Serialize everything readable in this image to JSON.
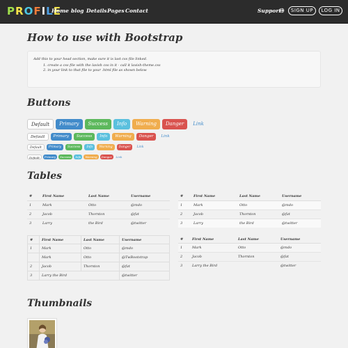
{
  "navbar": {
    "brand": [
      "P",
      "R",
      "O",
      "F",
      "I",
      "L",
      "E"
    ],
    "brand_colors": [
      "#a0e04c",
      "#f7e34a",
      "#4cc7e6",
      "#f57c3a",
      "#e6e6e6",
      "#4ca0e6",
      "#f7e34a"
    ],
    "links": [
      "Home",
      "blog",
      "Details",
      "Pages",
      "Contact"
    ],
    "support": "Support",
    "signup": "SIGN UP",
    "login": "LOG IN"
  },
  "main": {
    "title": "How to use with Bootstrap",
    "well": {
      "intro": "Add this to your head section, make sure it is last css file linked.",
      "step1": "1. create a css file with the lavish css in it - call it lavish-theme.css",
      "step2": "2. in your link to that file to your .html file as shown below"
    }
  },
  "buttons": {
    "heading": "Buttons",
    "labels": [
      "Default",
      "Primary",
      "Success",
      "Info",
      "Warning",
      "Danger",
      "Link"
    ]
  },
  "tables": {
    "heading": "Tables",
    "headers": [
      "#",
      "First Name",
      "Last Name",
      "Username"
    ],
    "rows": [
      [
        "1",
        "Mark",
        "Otto",
        "@mdo"
      ],
      [
        "2",
        "Jacob",
        "Thornton",
        "@fat"
      ],
      [
        "3",
        "Larry",
        "the Bird",
        "@twitter"
      ]
    ],
    "bordered_rows": [
      [
        "1",
        "Mark",
        "Otto",
        "@mdo"
      ],
      [
        "",
        "Mark",
        "Otto",
        "@TwBootstrap"
      ],
      [
        "2",
        "Jacob",
        "Thornton",
        "@fat"
      ],
      [
        "3",
        "Larry the Bird",
        "",
        "@twitter"
      ]
    ],
    "condensed_rows": [
      [
        "1",
        "Mark",
        "Otto",
        "@mdo"
      ],
      [
        "2",
        "Jacob",
        "Thornton",
        "@fat"
      ],
      [
        "3",
        "Larry the Bird",
        "",
        "@twitter"
      ]
    ]
  },
  "thumbnails": {
    "heading": "Thumbnails"
  }
}
